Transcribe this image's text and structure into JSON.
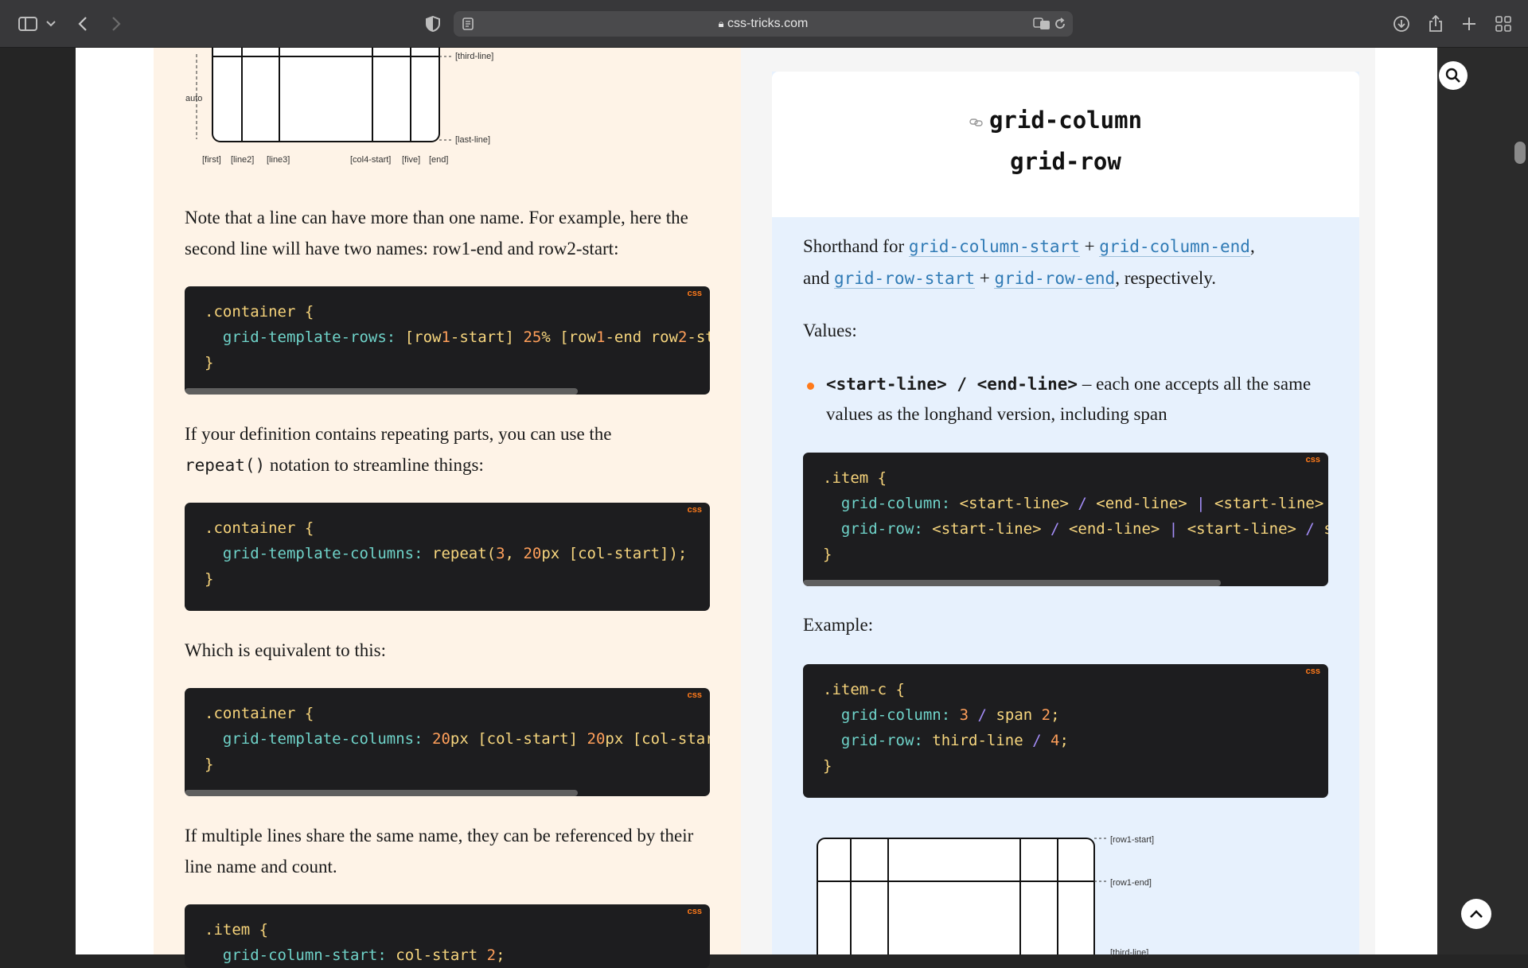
{
  "browser": {
    "url": "css-tricks.com"
  },
  "left": {
    "diagram_labels": {
      "third_line": "[third-line]",
      "last_line": "[last-line]",
      "auto": "auto",
      "first": "[first]",
      "line2": "[line2]",
      "line3": "[line3]",
      "col4_start": "[col4-start]",
      "five": "[five]",
      "end": "[end]"
    },
    "para1": "Note that a line can have more than one name. For example, here the second line will have two names: row1-end and row2-start:",
    "para2_a": "If your definition contains repeating parts, you can use the ",
    "para2_code": "repeat()",
    "para2_b": " notation to streamline things:",
    "para3": "Which is equivalent to this:",
    "para4": "If multiple lines share the same name, they can be referenced by their line name and count.",
    "code_lang": "css"
  },
  "right": {
    "title_line1": "grid-column",
    "title_line2": "grid-row",
    "shorthand_prefix": "Shorthand for ",
    "link1": "grid-column-start",
    "plus": "+",
    "link2": "grid-column-end",
    "and": "and ",
    "link3": "grid-row-start",
    "link4": "grid-row-end",
    "respectively": ", respectively.",
    "values_label": "Values:",
    "bullet_code": "<start-line> / <end-line>",
    "bullet_text": " – each one accepts all the same values as the longhand version, including span",
    "example_label": "Example:",
    "diagram_labels": {
      "row1_start": "[row1-start]",
      "row1_end": "[row1-end]",
      "third_line": "[third-line]"
    },
    "code_lang": "css"
  },
  "colors": {
    "accent": "#ff7a1a",
    "link": "#2f7ab5",
    "code_bg": "#1d1d1f",
    "left_bg": "#fef3e7",
    "card_bg": "#e7f1fd"
  }
}
